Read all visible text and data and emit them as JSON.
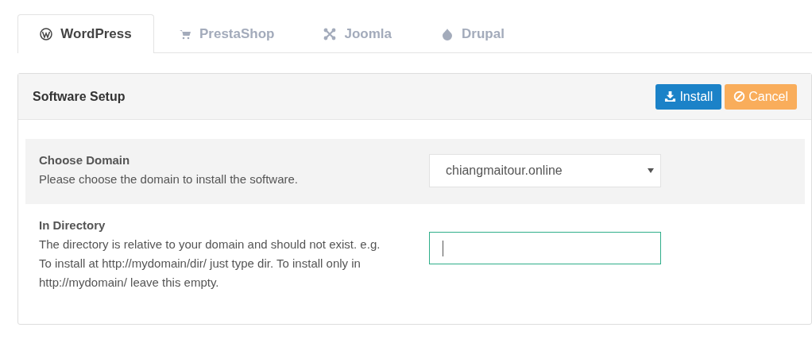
{
  "tabs": [
    {
      "label": "WordPress",
      "kind": "wordpress",
      "selected": true
    },
    {
      "label": "PrestaShop",
      "kind": "cart",
      "selected": false
    },
    {
      "label": "Joomla",
      "kind": "joomla",
      "selected": false
    },
    {
      "label": "Drupal",
      "kind": "drop",
      "selected": false
    }
  ],
  "panel": {
    "title": "Software Setup",
    "buttons": [
      {
        "label": "Install",
        "kind": "install"
      },
      {
        "label": "Cancel",
        "kind": "cancel"
      }
    ]
  },
  "fields": [
    {
      "kind": "select",
      "shaded": true,
      "label": "Choose Domain",
      "description": "Please choose the domain to install the software.",
      "value": "chiangmaitour.online"
    },
    {
      "kind": "text",
      "shaded": false,
      "label": "In Directory",
      "description": "The directory is relative to your domain and should not exist. e.g. To install at http://mydomain/dir/ just type dir. To install only in http://mydomain/ leave this empty.",
      "focused": true
    }
  ]
}
